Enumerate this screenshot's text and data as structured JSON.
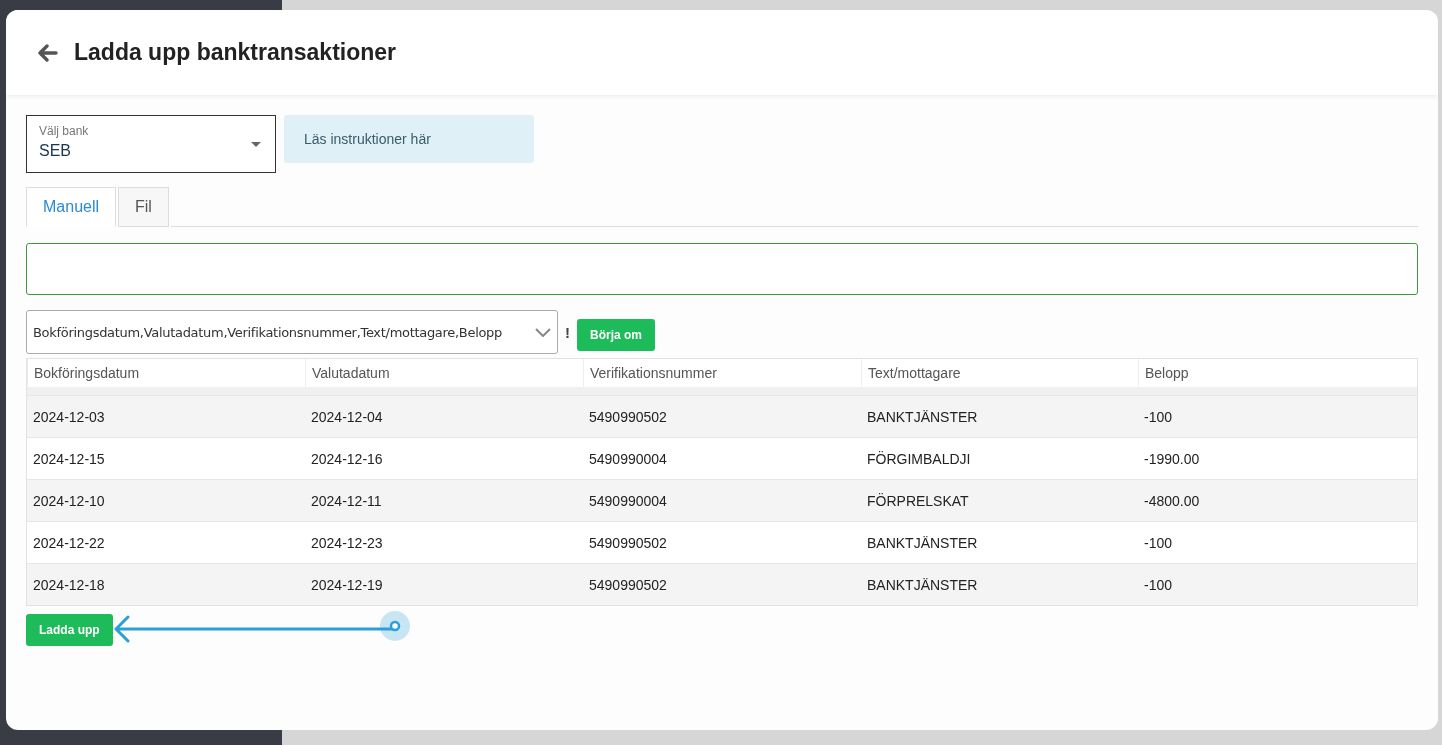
{
  "header": {
    "title": "Ladda upp banktransaktioner"
  },
  "bank_select": {
    "label": "Välj bank",
    "value": "SEB"
  },
  "instructions_link": "Läs instruktioner här",
  "tabs": [
    {
      "label": "Manuell",
      "selected": true
    },
    {
      "label": "Fil",
      "selected": false
    }
  ],
  "column_mapping": {
    "value": "Bokföringsdatum,Valutadatum,Verifikationsnummer,Text/mottagare,Belopp",
    "warning": "!",
    "reset_button": "Börja om"
  },
  "table": {
    "columns": [
      "Bokföringsdatum",
      "Valutadatum",
      "Verifikationsnummer",
      "Text/mottagare",
      "Belopp"
    ],
    "rows": [
      [
        "2024-12-03",
        "2024-12-04",
        "5490990502",
        "BANKTJÄNSTER",
        "-100"
      ],
      [
        "2024-12-15",
        "2024-12-16",
        "5490990004",
        "FÖRGIMBALDJI",
        "-1990.00"
      ],
      [
        "2024-12-10",
        "2024-12-11",
        "5490990004",
        "FÖRPRELSKAT",
        "-4800.00"
      ],
      [
        "2024-12-22",
        "2024-12-23",
        "5490990502",
        "BANKTJÄNSTER",
        "-100"
      ],
      [
        "2024-12-18",
        "2024-12-19",
        "5490990502",
        "BANKTJÄNSTER",
        "-100"
      ]
    ]
  },
  "upload_button": "Ladda upp"
}
